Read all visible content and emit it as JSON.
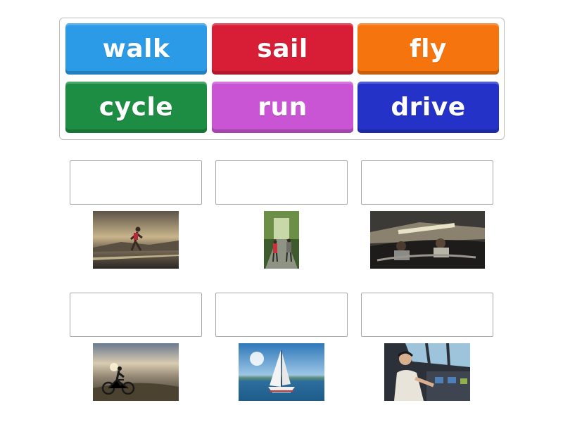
{
  "word_tiles": [
    {
      "label": "walk",
      "color": "#2b9be8"
    },
    {
      "label": "sail",
      "color": "#d71e36"
    },
    {
      "label": "fly",
      "color": "#f6740e"
    },
    {
      "label": "cycle",
      "color": "#1e8d44"
    },
    {
      "label": "run",
      "color": "#c955d4"
    },
    {
      "label": "drive",
      "color": "#2532c8"
    }
  ],
  "answer_slots": [
    {
      "value": "",
      "picture": "runner-at-sunset-image"
    },
    {
      "value": "",
      "picture": "people-walking-forest-path-image"
    },
    {
      "value": "",
      "picture": "convertible-car-driving-image"
    },
    {
      "value": "",
      "picture": "cyclist-on-hill-image"
    },
    {
      "value": "",
      "picture": "sailboat-on-lake-image"
    },
    {
      "value": "",
      "picture": "pilot-in-cockpit-image"
    }
  ]
}
